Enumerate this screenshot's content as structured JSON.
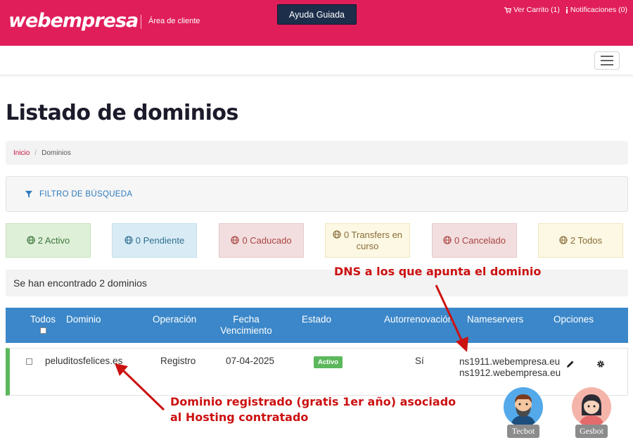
{
  "header": {
    "logo_text": "webempresa",
    "area_label": "Área de cliente",
    "ayuda_button": "Ayuda Guiada",
    "cart_link": "Ver Carrito (1)",
    "notifications_link": "Notificaciones (0)",
    "brand_color": "#e01e5a"
  },
  "page": {
    "title": "Listado de dominios"
  },
  "breadcrumb": {
    "home": "Inicio",
    "separator": "/",
    "current": "Dominios"
  },
  "filter": {
    "label": "FILTRO DE BÚSQUEDA"
  },
  "status_counts": {
    "activo": "2 Activo",
    "pendiente": "0 Pendiente",
    "caducado": "0 Caducado",
    "transfers": "0 Transfers en curso",
    "cancelado": "0 Cancelado",
    "todos": "2 Todos"
  },
  "results": {
    "found_text": "Se han encontrado 2 dominios"
  },
  "table": {
    "headers": {
      "todos": "Todos",
      "dominio": "Dominio",
      "operacion": "Operación",
      "fecha": "Fecha Vencimiento",
      "estado": "Estado",
      "autorrenovacion": "Autorrenovación",
      "nameservers": "Nameservers",
      "opciones": "Opciones"
    },
    "rows": [
      {
        "dominio": "peluditosfelices.es",
        "operacion": "Registro",
        "fecha": "07-04-2025",
        "estado": "Activo",
        "autorrenovacion": "Sí",
        "ns1": "ns1911.webempresa.eu",
        "ns2": "ns1912.webempresa.eu"
      }
    ]
  },
  "annotations": {
    "dns_note": "DNS a los que apunta el dominio",
    "domain_note_line1": "Dominio registrado (gratis 1er año) asociado",
    "domain_note_line2": "al Hosting contratado"
  },
  "bots": {
    "tecbot": "Tecbot",
    "gesbot": "Gesbot"
  }
}
